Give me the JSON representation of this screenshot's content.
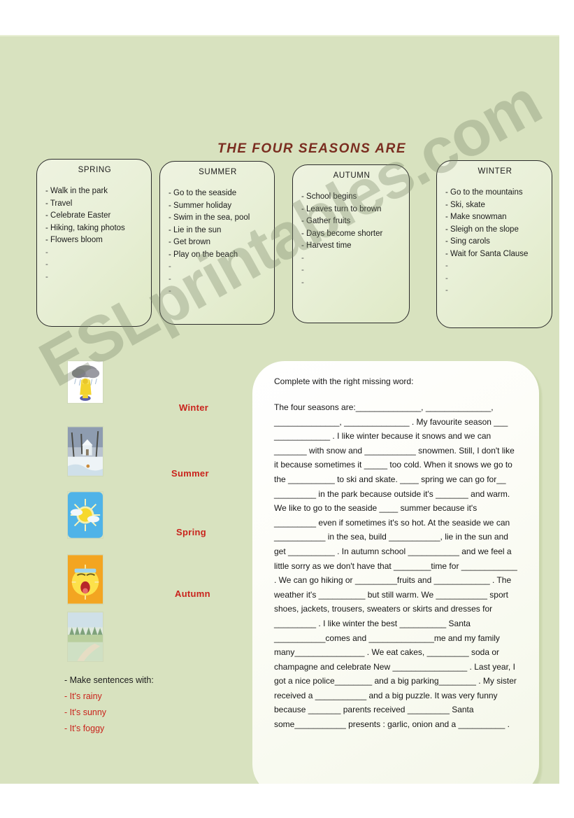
{
  "worksheet": {
    "title": "THE  FOUR  SEASONS  ARE",
    "watermark": "ESLprintables.com"
  },
  "cards": [
    {
      "name": "spring",
      "title": "SPRING",
      "items": [
        "- Walk in the park",
        "- Travel",
        "- Celebrate Easter",
        "- Hiking, taking photos",
        "- Flowers bloom",
        "-",
        "-",
        "-"
      ]
    },
    {
      "name": "summer",
      "title": "SUMMER",
      "items": [
        "- Go to the seaside",
        "- Summer holiday",
        "- Swim in the sea, pool",
        "- Lie in the sun",
        "- Get brown",
        "- Play on the beach",
        "-",
        "-",
        "-"
      ]
    },
    {
      "name": "autumn",
      "title": "AUTUMN",
      "items": [
        "- School begins",
        "- Leaves turn to brown",
        "- Gather fruits",
        "- Days become shorter",
        "- Harvest time",
        "-",
        "-",
        "-"
      ]
    },
    {
      "name": "winter",
      "title": "WINTER",
      "items": [
        "- Go to the mountains",
        "- Ski, skate",
        "- Make snowman",
        "- Sleigh on the slope",
        "- Sing carols",
        "- Wait for Santa Clause",
        "-",
        "-",
        "-"
      ]
    }
  ],
  "matching": {
    "images": [
      {
        "name": "rainy",
        "alt": "rainy-weather-picture"
      },
      {
        "name": "snowy",
        "alt": "snowy-village-picture"
      },
      {
        "name": "sunny",
        "alt": "sunny-sky-picture"
      },
      {
        "name": "hot",
        "alt": "hot-sun-picture"
      },
      {
        "name": "meadow",
        "alt": "spring-meadow-picture"
      }
    ],
    "words": [
      {
        "name": "winter",
        "label": "Winter"
      },
      {
        "name": "summer",
        "label": "Summer"
      },
      {
        "name": "spring",
        "label": "Spring"
      },
      {
        "name": "autumn",
        "label": "Autumn"
      }
    ]
  },
  "sentences": {
    "heading": "- Make sentences with:",
    "items": [
      "- It's rainy",
      "- It's sunny",
      "- It's foggy"
    ]
  },
  "exercise": {
    "lead": "Complete with the right missing word:",
    "body": "The four seasons are:______________, ______________, ______________, ______________ . My favourite season ___ ____________ . I like winter because it snows and we can _______ with snow and ___________ snowmen. Still, I don't like it because sometimes it _____ too cold. When it snows we go to the __________ to ski and skate. ____ spring we can go for__ _________ in the park because outside it's _______ and warm. We like to go to the seaside ____ summer because it's _________ even if sometimes it's so hot. At the seaside we can ___________ in the sea, build ___________, lie in the sun and get __________ . In autumn school ___________ and we feel a little sorry as we don't have that ________time for ____________ . We can go hiking or _________fruits and ____________ . The weather it's __________ but still warm. We ___________ sport shoes, jackets, trousers, sweaters or skirts and dresses for _________ . I like winter the best __________ Santa ___________comes and ______________me and my family many_______________ . We eat cakes, _________ soda or champagne and celebrate New ________________ . Last year, I got a nice police________ and a big parking________ . My sister received a ___________ and a big puzzle. It was very funny because _______ parents received _________ Santa some___________ presents : garlic, onion and a __________ ."
  },
  "colors": {
    "page_background": "#d8e2bf",
    "title_color": "#7a2d20",
    "season_word_color": "#c9231c",
    "card_border": "#2b2b2b"
  }
}
